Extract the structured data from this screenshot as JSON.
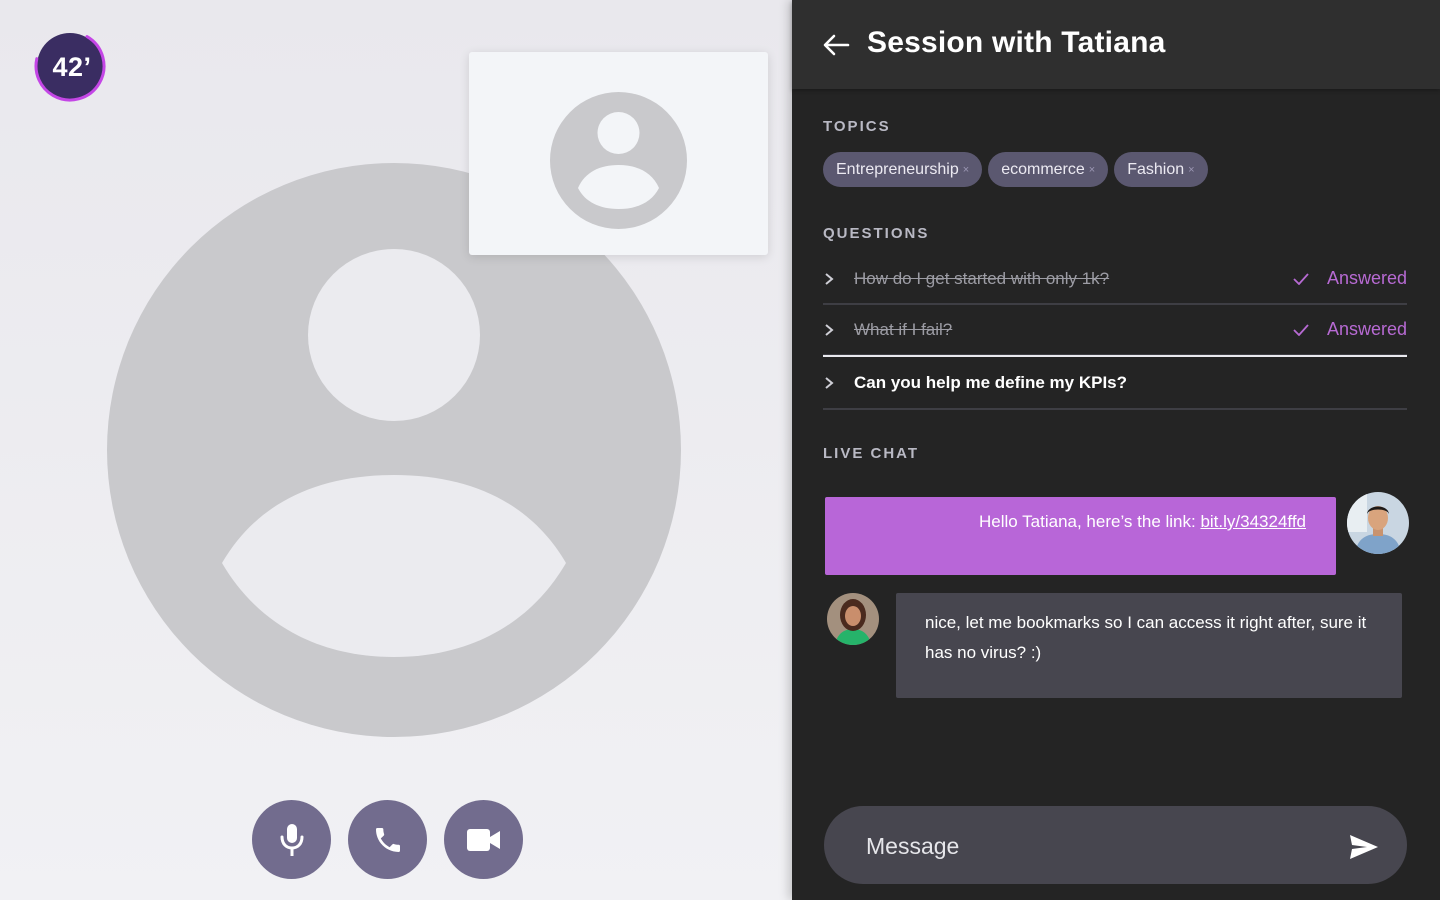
{
  "timer": {
    "label": "42’",
    "progress": 0.7
  },
  "colors": {
    "accent": "#b866d8",
    "control_bg": "#726c8e",
    "panel_bg": "#242424",
    "tag_bg": "#5b5870"
  },
  "controls": [
    {
      "name": "mic",
      "icon": "mic-icon"
    },
    {
      "name": "phone",
      "icon": "phone-icon"
    },
    {
      "name": "camera",
      "icon": "video-camera-icon"
    }
  ],
  "header": {
    "title": "Session with Tatiana",
    "back_icon": "arrow-left-icon"
  },
  "topics": {
    "label": "TOPICS",
    "tags": [
      {
        "label": "Entrepreneurship",
        "remove": "×"
      },
      {
        "label": "ecommerce",
        "remove": "×"
      },
      {
        "label": "Fashion",
        "remove": "×"
      }
    ]
  },
  "questions": {
    "label": "QUESTIONS",
    "items": [
      {
        "text": "How do I get started with only 1k?",
        "status": "Answered",
        "answered": true
      },
      {
        "text": "What if I fail?",
        "status": "Answered",
        "answered": true
      },
      {
        "text": "Can you help me define my KPIs?",
        "status": "",
        "answered": false
      }
    ]
  },
  "chat": {
    "label": "LIVE CHAT",
    "messages": [
      {
        "sender": "me",
        "text": "Hello Tatiana, here’s the link: ",
        "link": "bit.ly/34324ffd"
      },
      {
        "sender": "them",
        "text": "nice, let me bookmarks so I can access it right after, sure it has no virus? :)"
      }
    ],
    "input_placeholder": "Message",
    "send_icon": "send-icon"
  }
}
